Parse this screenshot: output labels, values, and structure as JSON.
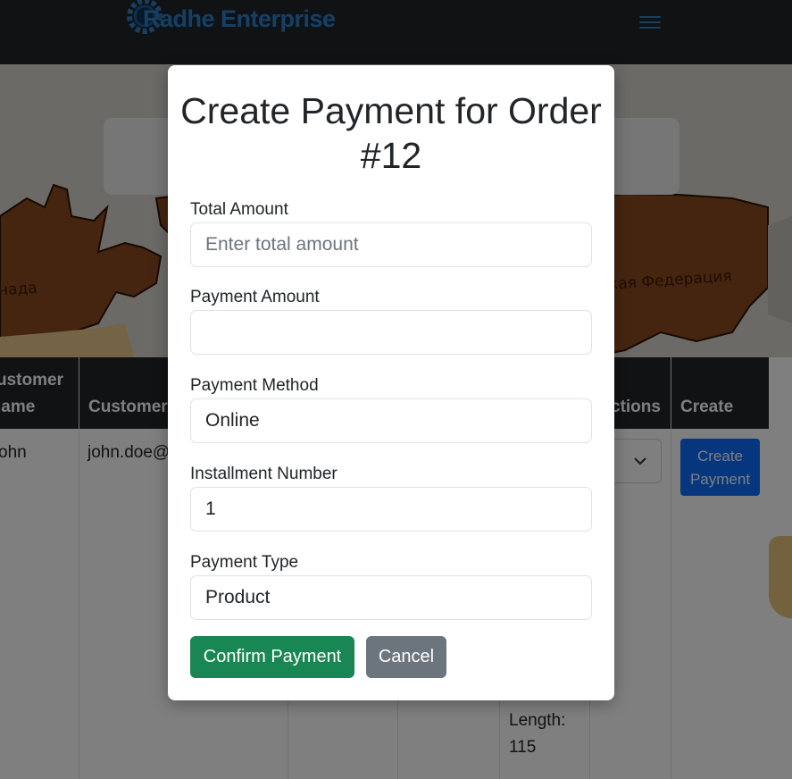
{
  "navbar": {
    "brand": "Radhe Enterprise",
    "brand_color": "#2f7fc4",
    "menu_icon": "hamburger-icon"
  },
  "map": {
    "label_left": "нада",
    "label_right": "кая Федерация"
  },
  "table": {
    "headers": [
      "ustomer\nlame",
      "Customer",
      "ctions",
      "Create"
    ],
    "row": {
      "name": "ohn",
      "email": "john.doe@",
      "length_label": "Length:",
      "length_value": "115",
      "create_button": "Create Payment",
      "select_icon": "chevron-down-icon"
    }
  },
  "modal": {
    "title": "Create Payment for Order #12",
    "fields": [
      {
        "label": "Total Amount",
        "value": "",
        "placeholder": "Enter total amount"
      },
      {
        "label": "Payment Amount",
        "value": "",
        "placeholder": ""
      },
      {
        "label": "Payment Method",
        "value": "Online",
        "placeholder": ""
      },
      {
        "label": "Installment Number",
        "value": "1",
        "placeholder": ""
      },
      {
        "label": "Payment Type",
        "value": "Product",
        "placeholder": ""
      }
    ],
    "confirm_button": "Confirm Payment",
    "cancel_button": "Cancel",
    "colors": {
      "confirm": "#198754",
      "cancel": "#6c757d",
      "primary": "#0d6efd"
    }
  }
}
